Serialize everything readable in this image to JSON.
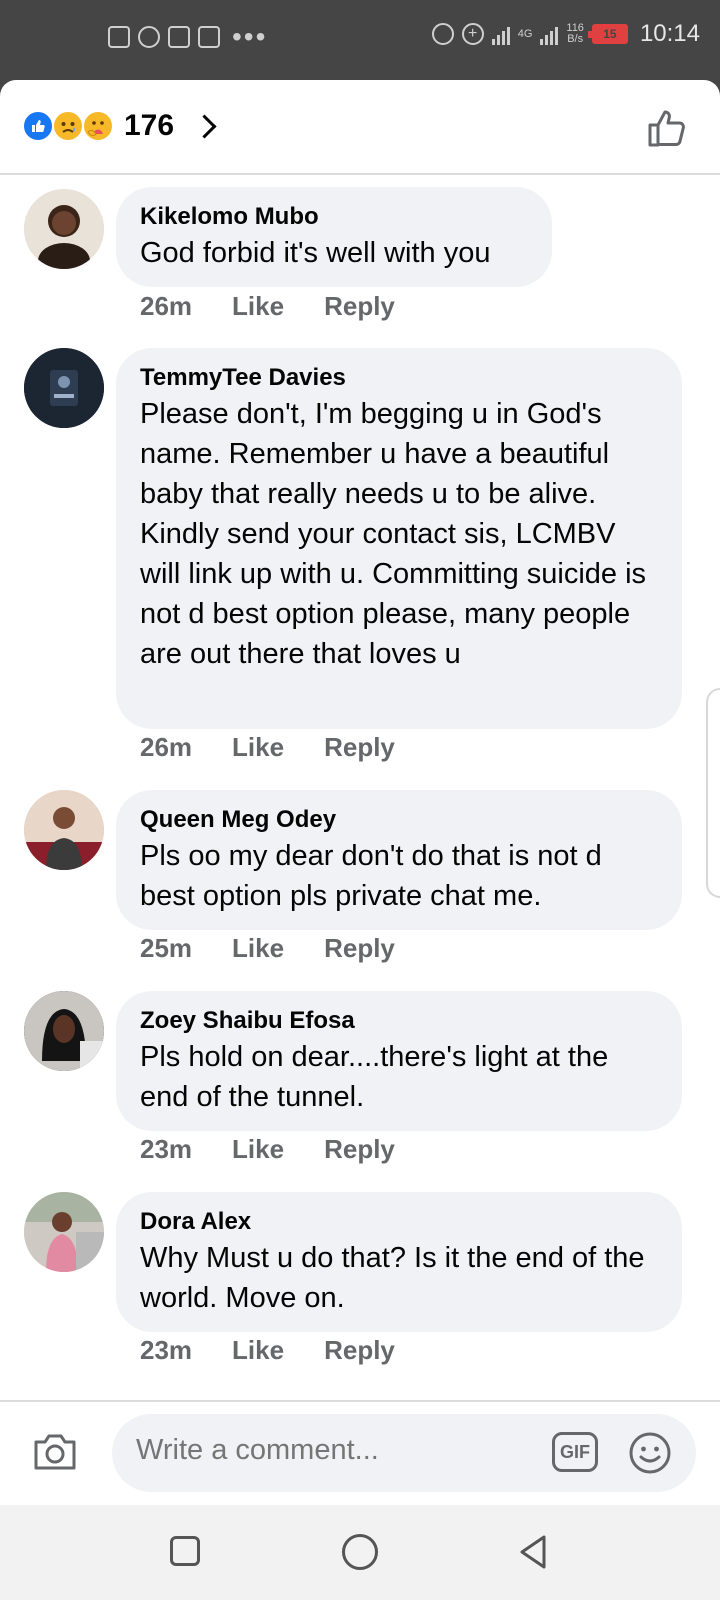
{
  "status_bar": {
    "network_type": "4G",
    "net_speed_value": "116",
    "net_speed_unit": "B/s",
    "battery_level": "15",
    "time": "10:14"
  },
  "header": {
    "reaction_icons": [
      "like-icon",
      "sad-icon",
      "care-icon"
    ],
    "reaction_count": "176"
  },
  "comments": [
    {
      "author": "Kikelomo Mubo",
      "text": "God forbid it's well with you",
      "time": "26m",
      "like_label": "Like",
      "reply_label": "Reply"
    },
    {
      "author": "TemmyTee Davies",
      "text": "Please don't, I'm begging u in God's name. Remember u have a beautiful baby that really needs u to be alive. Kindly send your contact sis, LCMBV will link up with u. Committing suicide is not d best option please, many people are out there that loves u",
      "time": "26m",
      "like_label": "Like",
      "reply_label": "Reply"
    },
    {
      "author": "Queen Meg Odey",
      "text": "Pls oo my dear don't do that is not d best option pls private chat me.",
      "time": "25m",
      "like_label": "Like",
      "reply_label": "Reply"
    },
    {
      "author": "Zoey Shaibu Efosa",
      "text": "Pls hold on dear....there's light at the end of the tunnel.",
      "time": "23m",
      "like_label": "Like",
      "reply_label": "Reply"
    },
    {
      "author": "Dora Alex",
      "text": "Why Must u do that? Is it the end of the world. Move on.",
      "time": "23m",
      "like_label": "Like",
      "reply_label": "Reply"
    }
  ],
  "composer": {
    "placeholder": "Write a comment...",
    "gif_label": "GIF"
  },
  "colors": {
    "like_blue": "#1877f2",
    "bubble_bg": "#f0f2f5",
    "meta_gray": "#65676b",
    "battery_red": "#e04040"
  }
}
